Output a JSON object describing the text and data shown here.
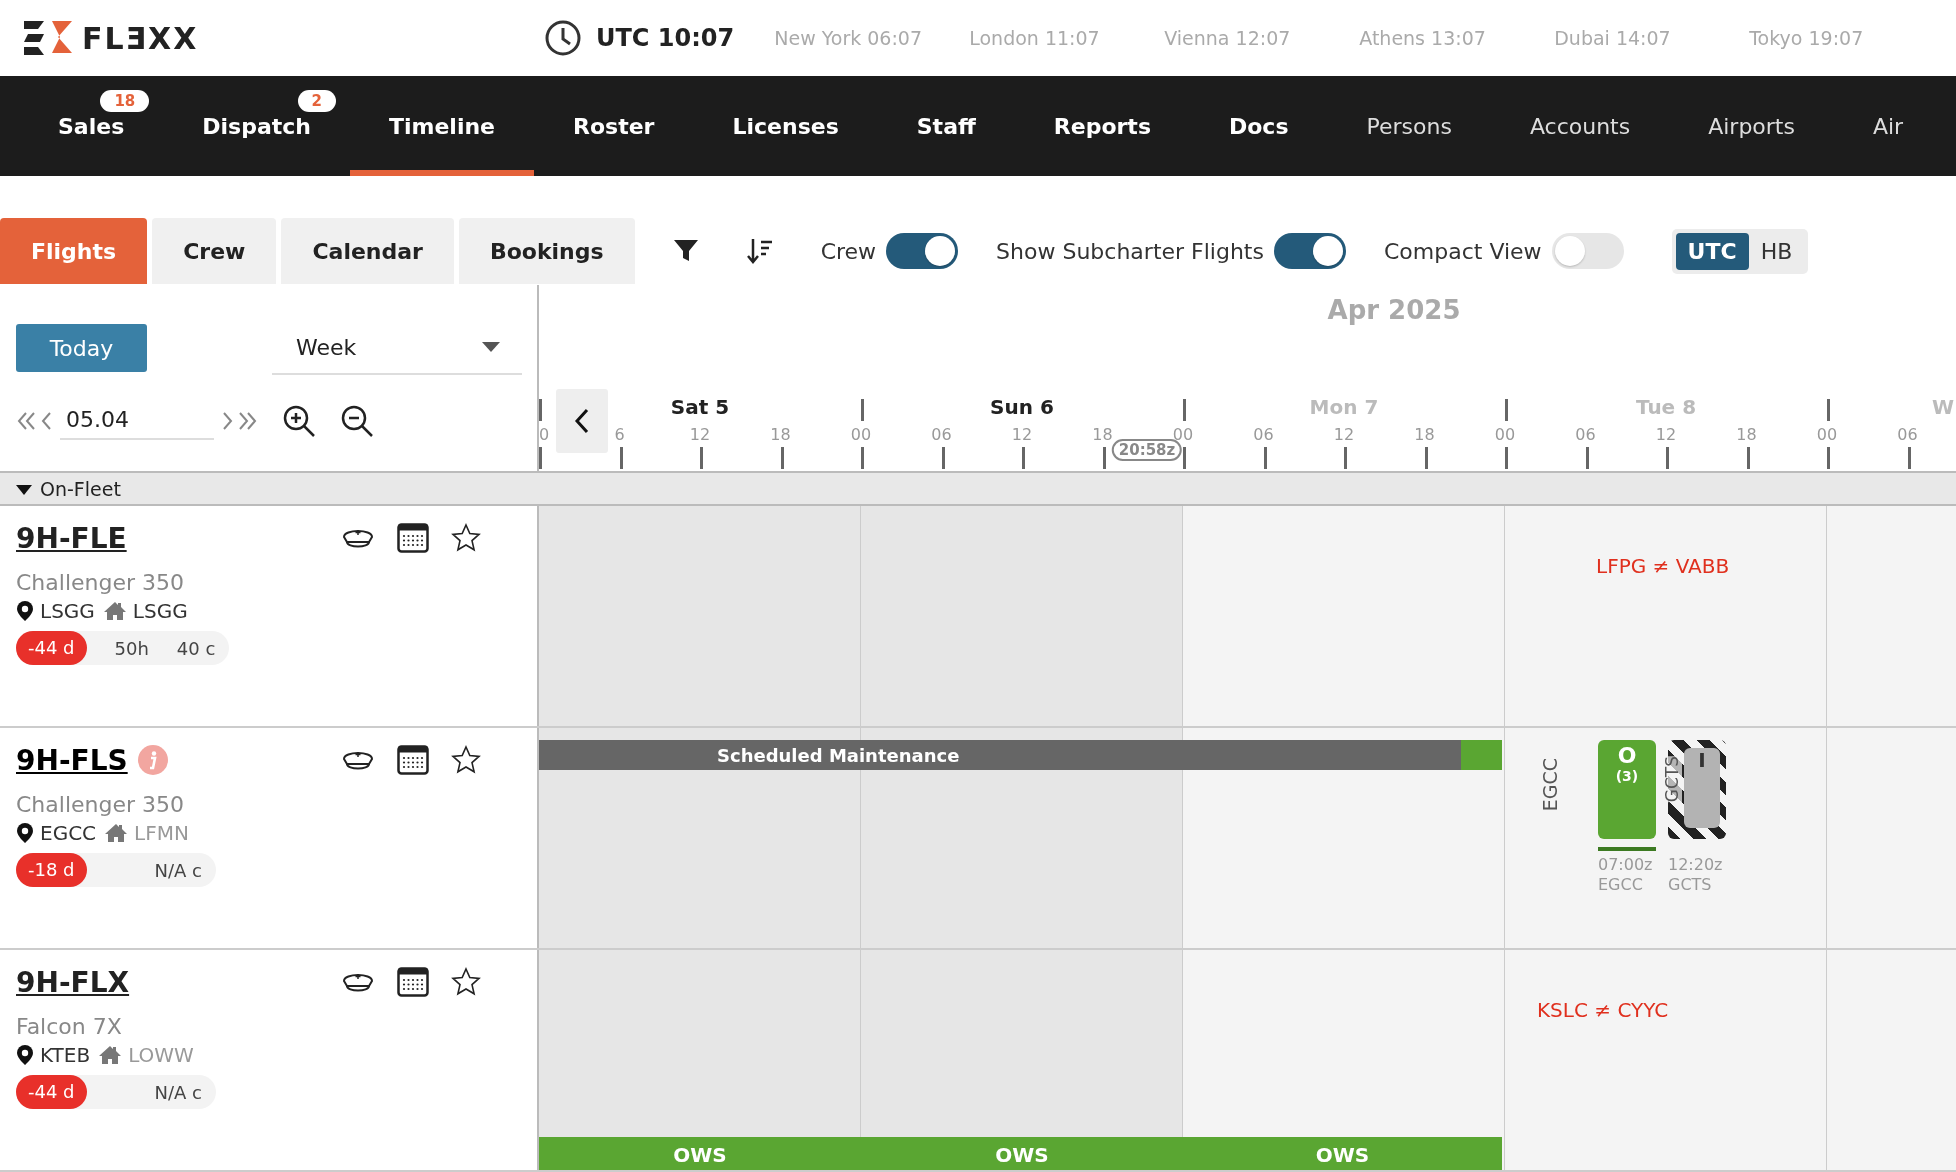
{
  "header": {
    "logo": "FLƎXX",
    "utc_clock": "UTC 10:07",
    "world_clocks": [
      "New York 06:07",
      "London 11:07",
      "Vienna 12:07",
      "Athens 13:07",
      "Dubai 14:07",
      "Tokyo 19:07"
    ]
  },
  "nav": [
    {
      "label": "Sales",
      "badge": "18",
      "kind": "main",
      "selected": false
    },
    {
      "label": "Dispatch",
      "badge": "2",
      "kind": "main",
      "selected": false
    },
    {
      "label": "Timeline",
      "kind": "main",
      "selected": true
    },
    {
      "label": "Roster",
      "kind": "main",
      "selected": false
    },
    {
      "label": "Licenses",
      "kind": "main",
      "selected": false
    },
    {
      "label": "Staff",
      "kind": "main",
      "selected": false
    },
    {
      "label": "Reports",
      "kind": "main",
      "selected": false
    },
    {
      "label": "Docs",
      "kind": "main",
      "selected": false
    },
    {
      "label": "Persons",
      "kind": "secondary",
      "selected": false
    },
    {
      "label": "Accounts",
      "kind": "secondary",
      "selected": false
    },
    {
      "label": "Airports",
      "kind": "secondary",
      "selected": false
    },
    {
      "label": "Air",
      "kind": "secondary",
      "selected": false
    }
  ],
  "view_tabs": [
    {
      "label": "Flights",
      "selected": true
    },
    {
      "label": "Crew",
      "selected": false
    },
    {
      "label": "Calendar",
      "selected": false
    },
    {
      "label": "Bookings",
      "selected": false
    }
  ],
  "toggles": [
    {
      "label": "Crew",
      "on": true
    },
    {
      "label": "Show Subcharter Flights",
      "on": true
    },
    {
      "label": "Compact View",
      "on": false
    }
  ],
  "time_mode": [
    {
      "label": "UTC",
      "selected": true
    },
    {
      "label": "HB",
      "selected": false
    }
  ],
  "controls": {
    "today": "Today",
    "range": "Week",
    "date": "05.04"
  },
  "timeline": {
    "month": "Apr 2025",
    "cursor_time": "20:58z",
    "days": [
      {
        "label": "Sat 5",
        "weekend": true,
        "ticks": [
          "0",
          "6",
          "12",
          "18"
        ]
      },
      {
        "label": "Sun 6",
        "weekend": true,
        "ticks": [
          "00",
          "06",
          "12",
          "18"
        ]
      },
      {
        "label": "Mon 7",
        "weekend": false,
        "ticks": [
          "00",
          "06",
          "12",
          "18"
        ]
      },
      {
        "label": "Tue 8",
        "weekend": false,
        "ticks": [
          "00",
          "06",
          "12",
          "18"
        ]
      },
      {
        "label": "W",
        "weekend": false,
        "ticks": [
          "00",
          "06"
        ]
      }
    ]
  },
  "group": {
    "label": "On-Fleet",
    "expanded": true
  },
  "aircraft": [
    {
      "registration": "9H-FLE",
      "info": false,
      "type": "Challenger 350",
      "location": "LSGG",
      "base": "LSGG",
      "at_base": true,
      "days": "-44 d",
      "hours": "50h",
      "cycles": "40 c",
      "events": [
        {
          "kind": "note",
          "text": "LFPG ≠ VABB"
        }
      ]
    },
    {
      "registration": "9H-FLS",
      "info": true,
      "type": "Challenger 350",
      "location": "EGCC",
      "base": "LFMN",
      "at_base": false,
      "days": "-18 d",
      "cycles": "N/A c",
      "events": [
        {
          "kind": "maintenance",
          "label": "Scheduled Maintenance"
        },
        {
          "kind": "airport",
          "text": "EGCC"
        },
        {
          "kind": "flight",
          "code": "O",
          "count": "(3)",
          "time": "07:00z",
          "airport": "EGCC"
        },
        {
          "kind": "blocked",
          "code": "I",
          "vertical": "GCTS",
          "time": "12:20z",
          "airport": "GCTS"
        }
      ]
    },
    {
      "registration": "9H-FLX",
      "info": false,
      "type": "Falcon 7X",
      "location": "KTEB",
      "base": "LOWW",
      "at_base": false,
      "days": "-44 d",
      "cycles": "N/A c",
      "events": [
        {
          "kind": "note",
          "text": "KSLC ≠ CYYC"
        },
        {
          "kind": "ows",
          "label": "OWS"
        },
        {
          "kind": "ows",
          "label": "OWS"
        },
        {
          "kind": "ows",
          "label": "OWS"
        }
      ]
    }
  ]
}
